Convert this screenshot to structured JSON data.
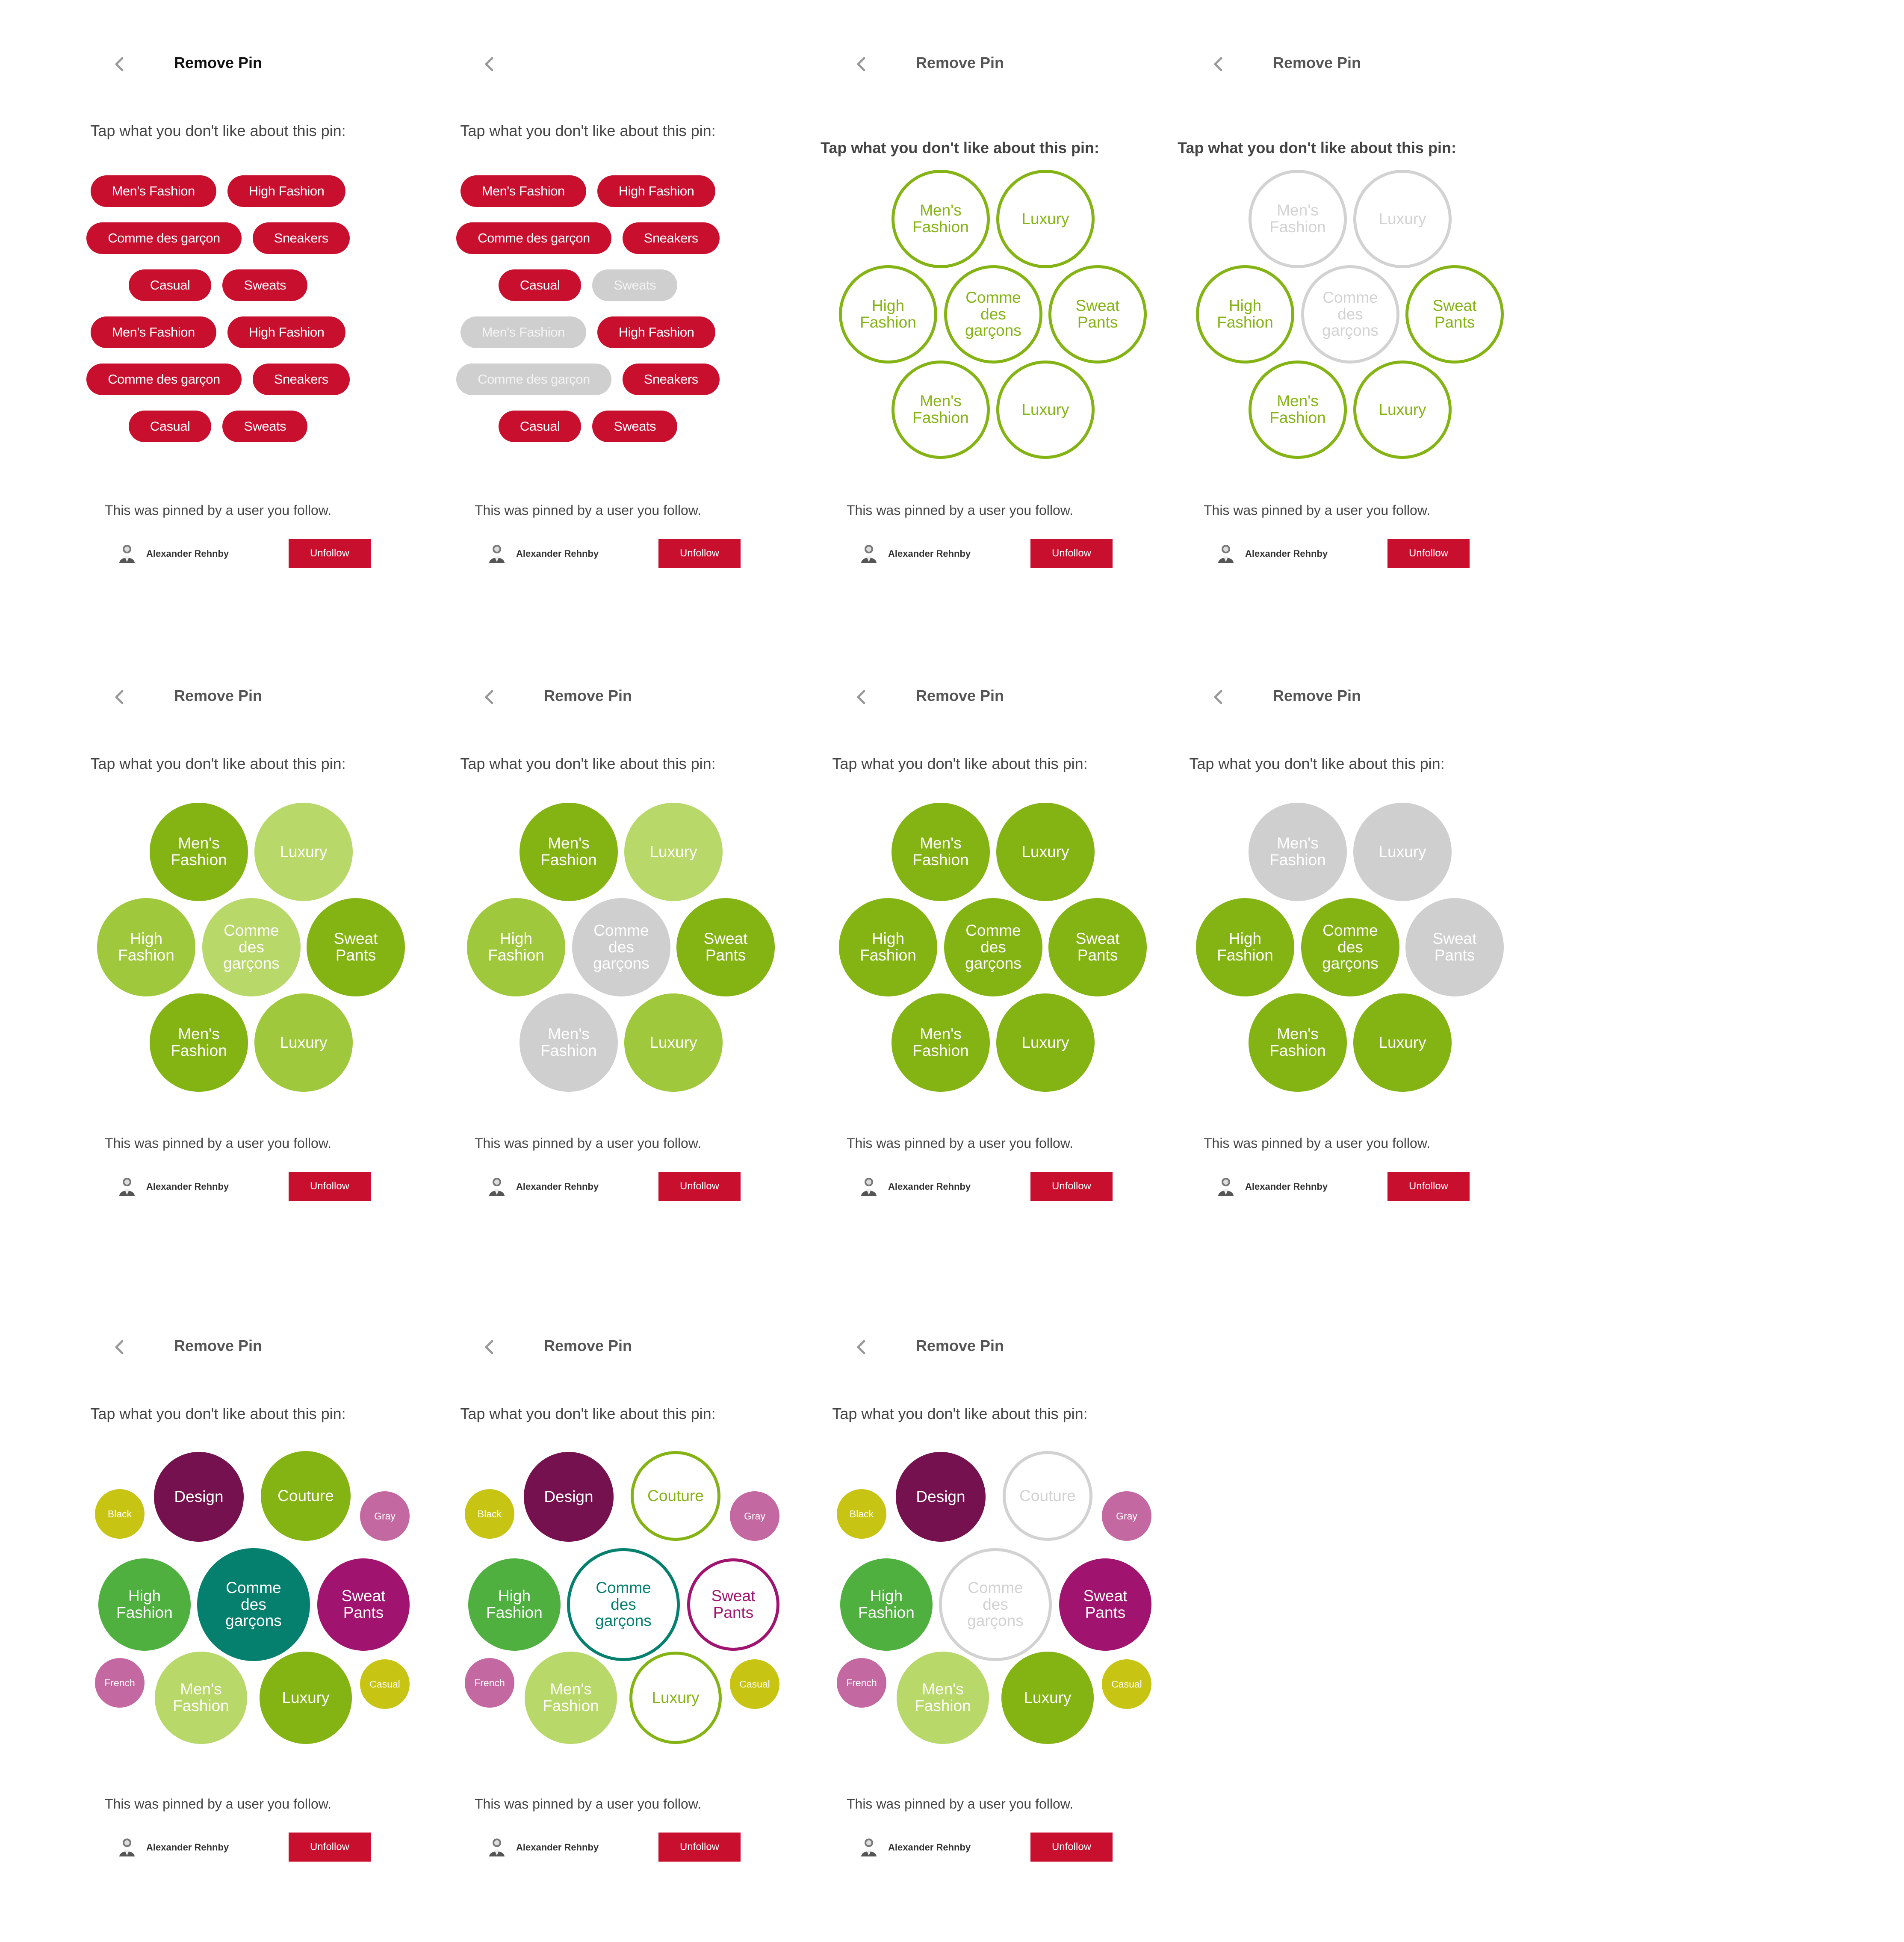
{
  "colors": {
    "accent_red": "#c8102e",
    "green_dark": "#84b414",
    "green_light": "#b8d86a",
    "green_mid": "#a0c83c",
    "gray_off": "#cfcfcf",
    "purple": "#74114e",
    "magenta": "#a01470",
    "teal": "#06806e",
    "leaf_green": "#4fb040",
    "olive": "#c8c414",
    "pink": "#c468a2"
  },
  "header": {
    "title": "Remove Pin",
    "back_icon": "chevron-left-icon"
  },
  "prompt": "Tap what you don't like about this pin:",
  "footer": {
    "pinned_text": "This was pinned by a user you follow.",
    "user_name": "Alexander Rehnby",
    "unfollow_label": "Unfollow",
    "avatar_icon": "user-avatar-icon"
  },
  "panels": [
    {
      "show_title": true,
      "title_dark": true,
      "bold_prompt": false,
      "kind": "chips",
      "chip_rows": [
        [
          {
            "label": "Men's Fashion",
            "on": true
          },
          {
            "label": "High Fashion",
            "on": true
          }
        ],
        [
          {
            "label": "Comme des garçon",
            "on": true
          },
          {
            "label": "Sneakers",
            "on": true
          }
        ],
        [
          {
            "label": "Casual",
            "on": true
          },
          {
            "label": "Sweats",
            "on": true
          }
        ],
        [
          {
            "label": "Men's Fashion",
            "on": true
          },
          {
            "label": "High Fashion",
            "on": true
          }
        ],
        [
          {
            "label": "Comme des garçon",
            "on": true
          },
          {
            "label": "Sneakers",
            "on": true
          }
        ],
        [
          {
            "label": "Casual",
            "on": true
          },
          {
            "label": "Sweats",
            "on": true
          }
        ]
      ]
    },
    {
      "show_title": false,
      "title_dark": false,
      "bold_prompt": false,
      "kind": "chips",
      "chip_rows": [
        [
          {
            "label": "Men's Fashion",
            "on": true
          },
          {
            "label": "High Fashion",
            "on": true
          }
        ],
        [
          {
            "label": "Comme des garçon",
            "on": true
          },
          {
            "label": "Sneakers",
            "on": true
          }
        ],
        [
          {
            "label": "Casual",
            "on": true
          },
          {
            "label": "Sweats",
            "on": false
          }
        ],
        [
          {
            "label": "Men's Fashion",
            "on": false
          },
          {
            "label": "High Fashion",
            "on": true
          }
        ],
        [
          {
            "label": "Comme des garçon",
            "on": false
          },
          {
            "label": "Sneakers",
            "on": true
          }
        ],
        [
          {
            "label": "Casual",
            "on": true
          },
          {
            "label": "Sweats",
            "on": true
          }
        ]
      ]
    },
    {
      "show_title": true,
      "title_dark": false,
      "bold_prompt": true,
      "kind": "bubbles7",
      "bubbles": [
        {
          "label": "Men's Fashion",
          "style": "outline-green"
        },
        {
          "label": "Luxury",
          "style": "outline-green"
        },
        {
          "label": "High Fashion",
          "style": "outline-green"
        },
        {
          "label": "Comme des garçons",
          "style": "outline-green"
        },
        {
          "label": "Sweat Pants",
          "style": "outline-green"
        },
        {
          "label": "Men's Fashion",
          "style": "outline-green"
        },
        {
          "label": "Luxury",
          "style": "outline-green"
        }
      ]
    },
    {
      "show_title": true,
      "title_dark": false,
      "bold_prompt": true,
      "kind": "bubbles7",
      "bubbles": [
        {
          "label": "Men's Fashion",
          "style": "outline-gray"
        },
        {
          "label": "Luxury",
          "style": "outline-gray"
        },
        {
          "label": "High Fashion",
          "style": "outline-green"
        },
        {
          "label": "Comme des garçons",
          "style": "outline-gray"
        },
        {
          "label": "Sweat Pants",
          "style": "outline-green"
        },
        {
          "label": "Men's Fashion",
          "style": "outline-green"
        },
        {
          "label": "Luxury",
          "style": "outline-green"
        }
      ]
    },
    {
      "show_title": true,
      "title_dark": false,
      "bold_prompt": false,
      "kind": "bubbles7",
      "bubbles": [
        {
          "label": "Men's Fashion",
          "style": "green-dark"
        },
        {
          "label": "Luxury",
          "style": "green-light"
        },
        {
          "label": "High Fashion",
          "style": "green-mid"
        },
        {
          "label": "Comme des garçons",
          "style": "green-light"
        },
        {
          "label": "Sweat Pants",
          "style": "green-dark"
        },
        {
          "label": "Men's Fashion",
          "style": "green-dark"
        },
        {
          "label": "Luxury",
          "style": "green-mid"
        }
      ]
    },
    {
      "show_title": true,
      "title_dark": false,
      "bold_prompt": false,
      "kind": "bubbles7",
      "bubbles": [
        {
          "label": "Men's Fashion",
          "style": "green-dark"
        },
        {
          "label": "Luxury",
          "style": "green-light"
        },
        {
          "label": "High Fashion",
          "style": "green-mid"
        },
        {
          "label": "Comme des garçons",
          "style": "gray"
        },
        {
          "label": "Sweat Pants",
          "style": "green-dark"
        },
        {
          "label": "Men's Fashion",
          "style": "gray"
        },
        {
          "label": "Luxury",
          "style": "green-mid"
        }
      ]
    },
    {
      "show_title": true,
      "title_dark": false,
      "bold_prompt": false,
      "kind": "bubbles7",
      "bubbles": [
        {
          "label": "Men's Fashion",
          "style": "green-dark"
        },
        {
          "label": "Luxury",
          "style": "green-dark"
        },
        {
          "label": "High Fashion",
          "style": "green-dark"
        },
        {
          "label": "Comme des garçons",
          "style": "green-dark"
        },
        {
          "label": "Sweat Pants",
          "style": "green-dark"
        },
        {
          "label": "Men's Fashion",
          "style": "green-dark"
        },
        {
          "label": "Luxury",
          "style": "green-dark"
        }
      ]
    },
    {
      "show_title": true,
      "title_dark": false,
      "bold_prompt": false,
      "kind": "bubbles7",
      "bubbles": [
        {
          "label": "Men's Fashion",
          "style": "gray"
        },
        {
          "label": "Luxury",
          "style": "gray"
        },
        {
          "label": "High Fashion",
          "style": "green-dark"
        },
        {
          "label": "Comme des garçons",
          "style": "green-dark"
        },
        {
          "label": "Sweat Pants",
          "style": "gray"
        },
        {
          "label": "Men's Fashion",
          "style": "green-dark"
        },
        {
          "label": "Luxury",
          "style": "green-dark"
        }
      ]
    },
    {
      "show_title": true,
      "title_dark": false,
      "bold_prompt": false,
      "kind": "bubbles13",
      "bubbles": [
        {
          "label": "Design",
          "style": "purple"
        },
        {
          "label": "Couture",
          "style": "green-dark"
        },
        {
          "label": "Black",
          "style": "olive"
        },
        {
          "label": "Gray",
          "style": "pink"
        },
        {
          "label": "High Fashion",
          "style": "leaf-green"
        },
        {
          "label": "Comme des garçons",
          "style": "teal"
        },
        {
          "label": "Sweat Pants",
          "style": "magenta"
        },
        {
          "label": "French",
          "style": "pink"
        },
        {
          "label": "Men's Fashion",
          "style": "green-light"
        },
        {
          "label": "Luxury",
          "style": "green-dark"
        },
        {
          "label": "Casual",
          "style": "olive"
        }
      ]
    },
    {
      "show_title": true,
      "title_dark": false,
      "bold_prompt": false,
      "kind": "bubbles13",
      "bubbles": [
        {
          "label": "Design",
          "style": "purple"
        },
        {
          "label": "Couture",
          "style": "outline-green"
        },
        {
          "label": "Black",
          "style": "olive"
        },
        {
          "label": "Gray",
          "style": "pink"
        },
        {
          "label": "High Fashion",
          "style": "leaf-green"
        },
        {
          "label": "Comme des garçons",
          "style": "outline-teal"
        },
        {
          "label": "Sweat Pants",
          "style": "outline-magenta"
        },
        {
          "label": "French",
          "style": "pink"
        },
        {
          "label": "Men's Fashion",
          "style": "green-light"
        },
        {
          "label": "Luxury",
          "style": "outline-green"
        },
        {
          "label": "Casual",
          "style": "olive"
        }
      ]
    },
    {
      "show_title": true,
      "title_dark": false,
      "bold_prompt": false,
      "kind": "bubbles13",
      "bubbles": [
        {
          "label": "Design",
          "style": "purple"
        },
        {
          "label": "Couture",
          "style": "outline-gray"
        },
        {
          "label": "Black",
          "style": "olive"
        },
        {
          "label": "Gray",
          "style": "pink"
        },
        {
          "label": "High Fashion",
          "style": "leaf-green"
        },
        {
          "label": "Comme des garçons",
          "style": "outline-gray"
        },
        {
          "label": "Sweat Pants",
          "style": "magenta"
        },
        {
          "label": "French",
          "style": "pink"
        },
        {
          "label": "Men's Fashion",
          "style": "green-light"
        },
        {
          "label": "Luxury",
          "style": "green-dark"
        },
        {
          "label": "Casual",
          "style": "olive"
        }
      ]
    }
  ]
}
